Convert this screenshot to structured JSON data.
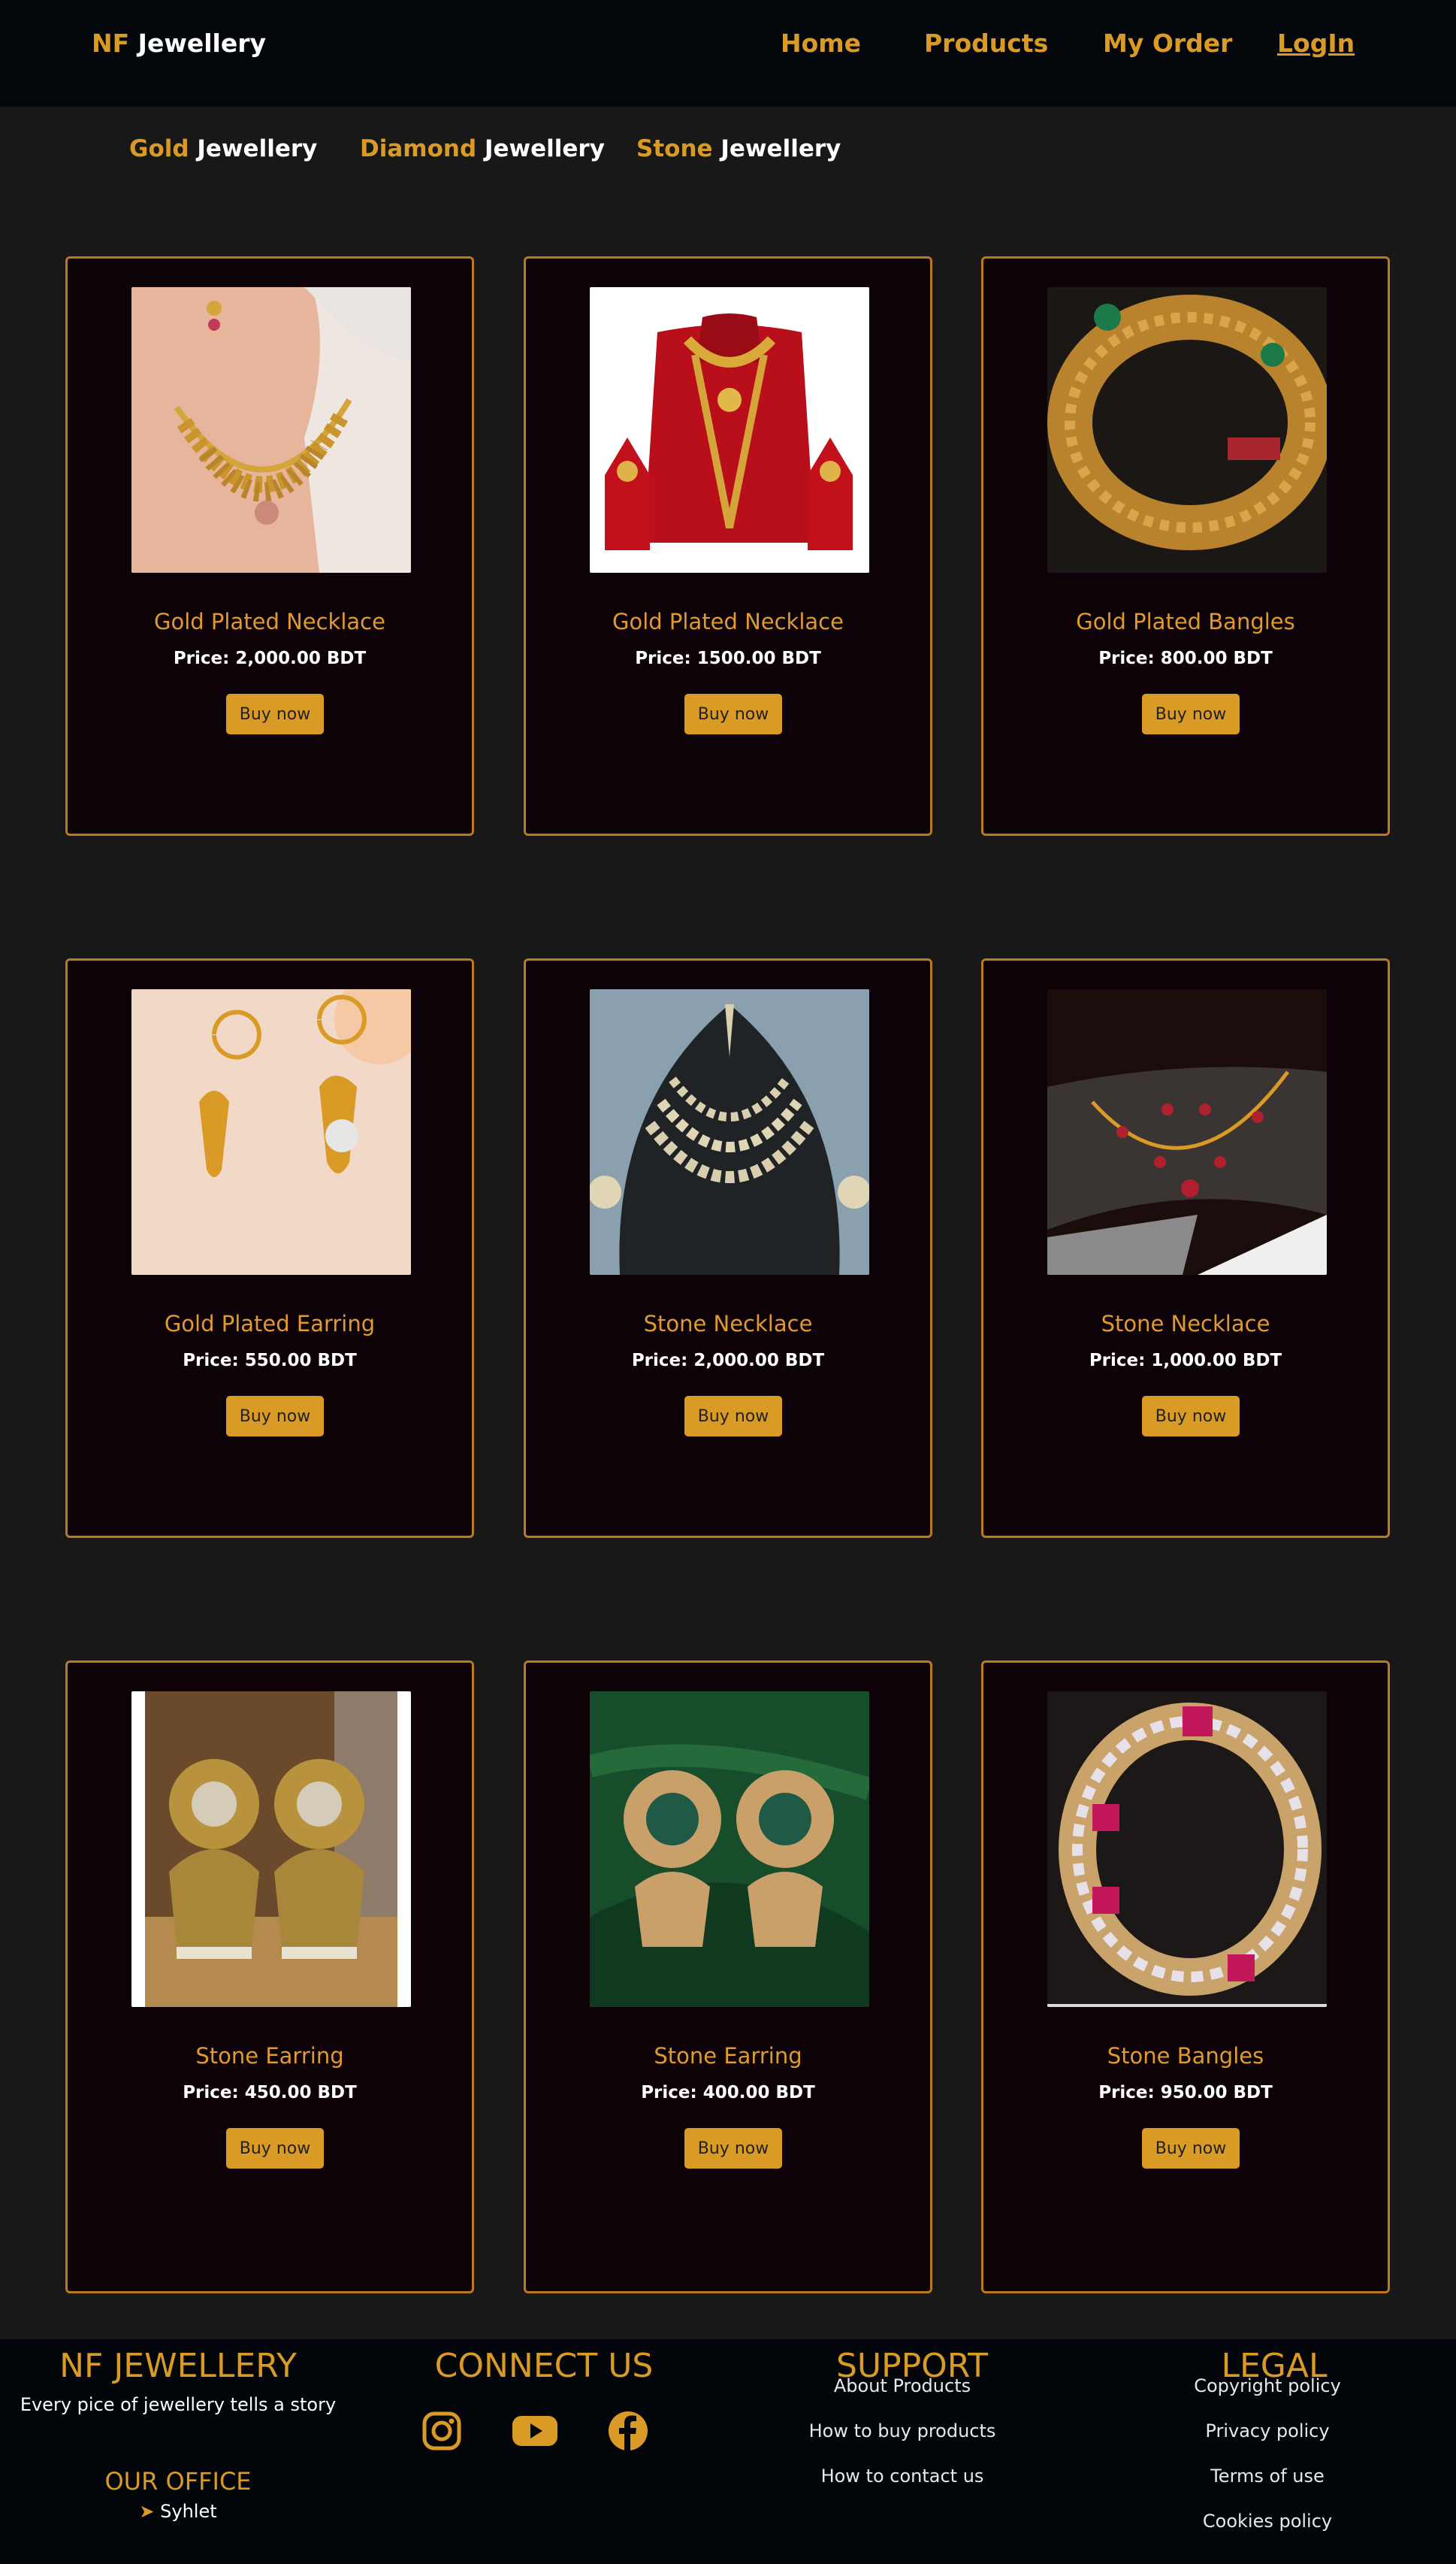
{
  "nav": {
    "brand_accent": "NF",
    "brand_rest": "Jewellery",
    "links": [
      "Home",
      "Products",
      "My Order",
      "LogIn"
    ]
  },
  "categories": [
    {
      "accent": "Gold",
      "rest": "Jewellery"
    },
    {
      "accent": "Diamond",
      "rest": "Jewellery"
    },
    {
      "accent": "Stone",
      "rest": "Jewellery"
    }
  ],
  "products": [
    {
      "title": "Gold Plated Necklace",
      "price": "Price: 2,000.00 BDT",
      "button": "Buy now",
      "image": "gold-necklace-model"
    },
    {
      "title": "Gold Plated Necklace",
      "price": "Price: 1500.00 BDT",
      "button": "Buy now",
      "image": "gold-necklace-set-red-stand"
    },
    {
      "title": "Gold Plated Bangles",
      "price": "Price: 800.00 BDT",
      "button": "Buy now",
      "image": "gold-bangle"
    },
    {
      "title": "Gold Plated Earring",
      "price": "Price: 550.00 BDT",
      "button": "Buy now",
      "image": "gold-drop-earrings"
    },
    {
      "title": "Stone Necklace",
      "price": "Price: 2,000.00 BDT",
      "button": "Buy now",
      "image": "layered-kundan-necklace"
    },
    {
      "title": "Stone Necklace",
      "price": "Price: 1,000.00 BDT",
      "button": "Buy now",
      "image": "ruby-vine-necklace"
    },
    {
      "title": "Stone Earring",
      "price": "Price: 450.00 BDT",
      "button": "Buy now",
      "image": "antique-jhumka"
    },
    {
      "title": "Stone Earring",
      "price": "Price: 400.00 BDT",
      "button": "Buy now",
      "image": "pearl-jhumka-green"
    },
    {
      "title": "Stone Bangles",
      "price": "Price: 950.00 BDT",
      "button": "Buy now",
      "image": "diamond-ruby-bangle"
    }
  ],
  "footer": {
    "brand": "NF JEWELLERY",
    "tagline": "Every pice of jewellery tells a story",
    "office_title": "OUR OFFICE",
    "office_location": "Syhlet",
    "connect_title": "CONNECT US",
    "social_icons": [
      "instagram-icon",
      "youtube-icon",
      "facebook-icon"
    ],
    "support_title": "SUPPORT",
    "support_links": [
      "About Products",
      "How to buy products",
      "How to contact us"
    ],
    "legal_title": "LEGAL",
    "legal_links": [
      "Copyright policy",
      "Privacy policy",
      "Terms of use",
      "Cookies policy"
    ]
  },
  "colors": {
    "accent": "#d99a26",
    "page_bg": "#181818",
    "card_bg": "#0e0209",
    "nav_bg": "#03070b"
  }
}
